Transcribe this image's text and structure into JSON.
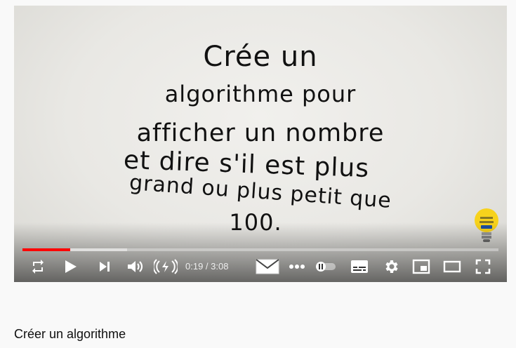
{
  "video": {
    "handwriting": [
      "Crée un",
      "algorithme pour",
      "afficher un nombre",
      "et dire s'il est plus",
      "grand ou plus petit que",
      "100."
    ],
    "progress_fraction": 0.101
  },
  "player": {
    "current_time": "0:19",
    "time_separator": " / ",
    "duration": "3:08",
    "icons": [
      "loop-icon",
      "play-icon",
      "next-icon",
      "volume-icon",
      "live-icon",
      "subscribe-envelope-icon",
      "more-icon",
      "autoplay-toggle-icon",
      "subtitles-icon",
      "settings-icon",
      "miniplayer-icon",
      "theater-mode-icon",
      "fullscreen-icon"
    ],
    "accent_color": "#ff0000"
  },
  "page": {
    "video_title": "Créer un algorithme"
  }
}
